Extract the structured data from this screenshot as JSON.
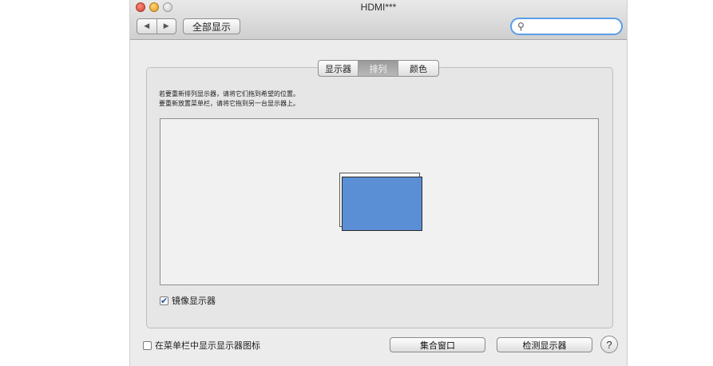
{
  "window": {
    "title": "HDMI***"
  },
  "toolbar": {
    "back_glyph": "◀",
    "forward_glyph": "▶",
    "show_all_label": "全部显示",
    "search_icon": "search-icon",
    "search_glyph": "⚲",
    "search_value": "",
    "search_placeholder": ""
  },
  "tabs": [
    {
      "label": "显示器",
      "selected": false
    },
    {
      "label": "排列",
      "selected": true
    },
    {
      "label": "颜色",
      "selected": false
    }
  ],
  "arrangement": {
    "instruction_1": "若要重新排列显示器，请将它们拖到希望的位置。",
    "instruction_2": "要重新放置菜单栏，请将它拖到另一台显示器上。",
    "display_color": "#5b8fd5"
  },
  "mirror": {
    "label": "镜像显示器",
    "checked": true,
    "check_glyph": "✔"
  },
  "footer": {
    "menubar_label": "在菜单栏中显示显示器图标",
    "menubar_checked": false,
    "gather_label": "集合窗口",
    "detect_label": "检测显示器",
    "help_glyph": "?"
  }
}
